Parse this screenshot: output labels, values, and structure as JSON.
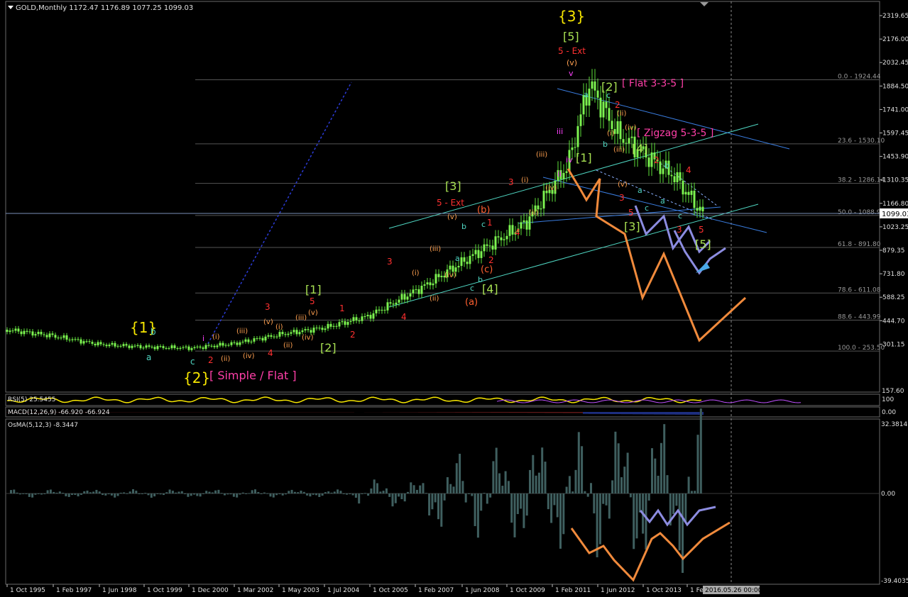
{
  "main": {
    "header": "GOLD,Monthly  1172.47 1176.89 1077.25 1099.03",
    "current_price": "1099.03",
    "axis_labels": [
      "2319.65",
      "2176.00",
      "2032.45",
      "1884.50",
      "1741.00",
      "1597.45",
      "1453.90",
      "1310.35",
      "1166.80",
      "1023.25",
      "879.35",
      "731.80",
      "588.25",
      "444.70",
      "301.15",
      "157.60"
    ],
    "fib_levels": [
      {
        "label": "0.0 - 1924.44",
        "value": 1924.44
      },
      {
        "label": "23.6 - 1530.10",
        "value": 1530.1
      },
      {
        "label": "38.2 - 1286.14",
        "value": 1286.14
      },
      {
        "label": "50.0 - 1088.97",
        "value": 1088.97
      },
      {
        "label": "61.8 - 891.80",
        "value": 891.8
      },
      {
        "label": "78.6 - 611.08",
        "value": 611.08
      },
      {
        "label": "88.6 - 443.99",
        "value": 443.99
      },
      {
        "label": "100.0 - 253.50",
        "value": 253.5
      }
    ]
  },
  "rsi": {
    "header": "RSI(5) 25.5455",
    "right_labels": [
      "100",
      "0.00"
    ]
  },
  "macd": {
    "header": "MACD(12,26,9) -66.920 -66.924",
    "right_label": "0.00"
  },
  "osma": {
    "header": "OsMA(5,12,3) -8.3447",
    "axis_labels": [
      "32.3814",
      "0.00",
      "-39.4035"
    ]
  },
  "time_axis": {
    "labels": [
      "1 Oct 1995",
      "1 Feb 1997",
      "1 Jun 1998",
      "1 Oct 1999",
      "1 Dec 2000",
      "1 Mar 2002",
      "1 May 2003",
      "1 Jul 2004",
      "1 Oct 2005",
      "1 Feb 2007",
      "1 Jun 2008",
      "1 Oct 2009",
      "1 Feb 2011",
      "1 Jun 2012",
      "1 Oct 2013",
      "1 Feb"
    ],
    "cursor": "2016.05.26 00:00"
  },
  "annotations": {
    "w1": "{1}",
    "w1b": "b",
    "w1a": "a",
    "w2": "{2}",
    "w2c": "c",
    "simple_flat": "[ Simple / Flat ]",
    "w3": "{3}",
    "w3_5": "[5]",
    "w3_ext": "5 - Ext",
    "w3_v": "(v)",
    "w3_vv": "v",
    "flat335": "[ Flat 3-3-5 ]",
    "sq2": "[2]",
    "zigzag": "[ Zigzag 5-3-5 ]",
    "sq4": "[4]",
    "sq1": "[1]",
    "sq3a": "[3]",
    "sq5": "[5]",
    "sq2b": "[2]",
    "sq1b": "[1]",
    "sq3b": "[3]",
    "ext5": "5 - Ext",
    "sq4b": "[4]",
    "wA": "(a)",
    "wB": "(b)",
    "wC": "(c)",
    "n1": "1",
    "n2": "2",
    "n3": "3",
    "n4": "4",
    "n5": "5",
    "ri": "(i)",
    "rii": "(ii)",
    "riii": "(iii)",
    "riv": "(iv)",
    "rv": "(v)",
    "li": "i",
    "lii": "ii",
    "liii": "iii",
    "liv": "iv",
    "la": "a",
    "lb": "b",
    "lc": "c"
  },
  "chart_data": {
    "type": "line",
    "title": "GOLD,Monthly",
    "x": [
      "1995-10",
      "1997-02",
      "1998-06",
      "1999-10",
      "2000-12",
      "2002-03",
      "2003-05",
      "2004-07",
      "2005-10",
      "2007-02",
      "2008-06",
      "2009-10",
      "2011-02",
      "2011-09",
      "2012-06",
      "2013-10",
      "2015-11"
    ],
    "series": [
      {
        "name": "GOLD",
        "values": [
          385,
          350,
          295,
          280,
          272,
          300,
          360,
          400,
          470,
          660,
          880,
          1040,
          1400,
          1900,
          1590,
          1330,
          1099
        ]
      }
    ],
    "ylim": [
      14.05,
      2319.65
    ],
    "grid": false,
    "osma_ylim": [
      -39.4035,
      32.3814
    ]
  }
}
